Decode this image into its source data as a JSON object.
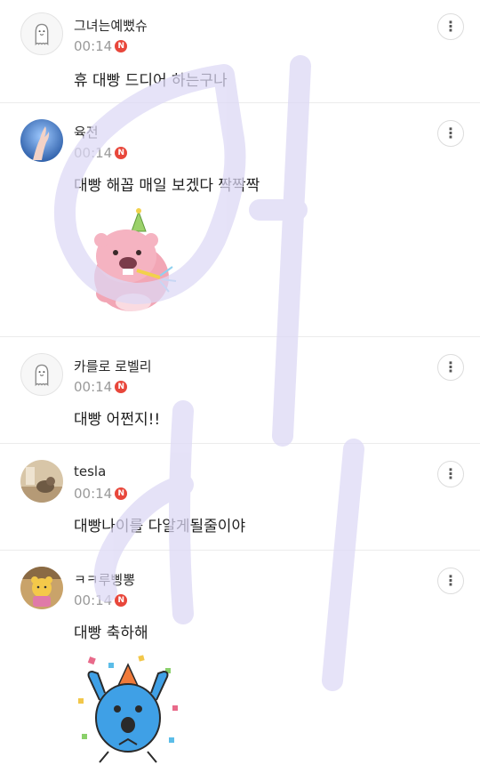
{
  "comments": [
    {
      "nickname": "그녀는예뻤슈",
      "time": "00:14",
      "new_badge": "N",
      "text": "휴 대빵 드디어 하는구나",
      "more_icon": "⋮",
      "avatar": "default-profile-icon"
    },
    {
      "nickname": "육전",
      "time": "00:14",
      "new_badge": "N",
      "text": "대빵 해꼽 매일 보겠다 짝짝짝",
      "more_icon": "⋮",
      "avatar": "hand-photo",
      "sticker": "beaver-party-sticker"
    },
    {
      "nickname": "카를로 로벨리",
      "time": "00:14",
      "new_badge": "N",
      "text": "대빵 어쩐지!!",
      "more_icon": "⋮",
      "avatar": "default-profile-icon"
    },
    {
      "nickname": "tesla",
      "time": "00:14",
      "new_badge": "N",
      "text": "대빵나이를 다알게될줄이야",
      "more_icon": "⋮",
      "avatar": "photo"
    },
    {
      "nickname": "ㅋㅋ루삥뽕",
      "time": "00:14",
      "new_badge": "N",
      "text": "대빵 축하해",
      "more_icon": "⋮",
      "avatar": "toy-photo",
      "sticker": "blue-character-celebration-sticker"
    }
  ],
  "colors": {
    "badge": "#e8473b",
    "scribble": "#dcd8f5",
    "time": "#9a9a9a"
  }
}
